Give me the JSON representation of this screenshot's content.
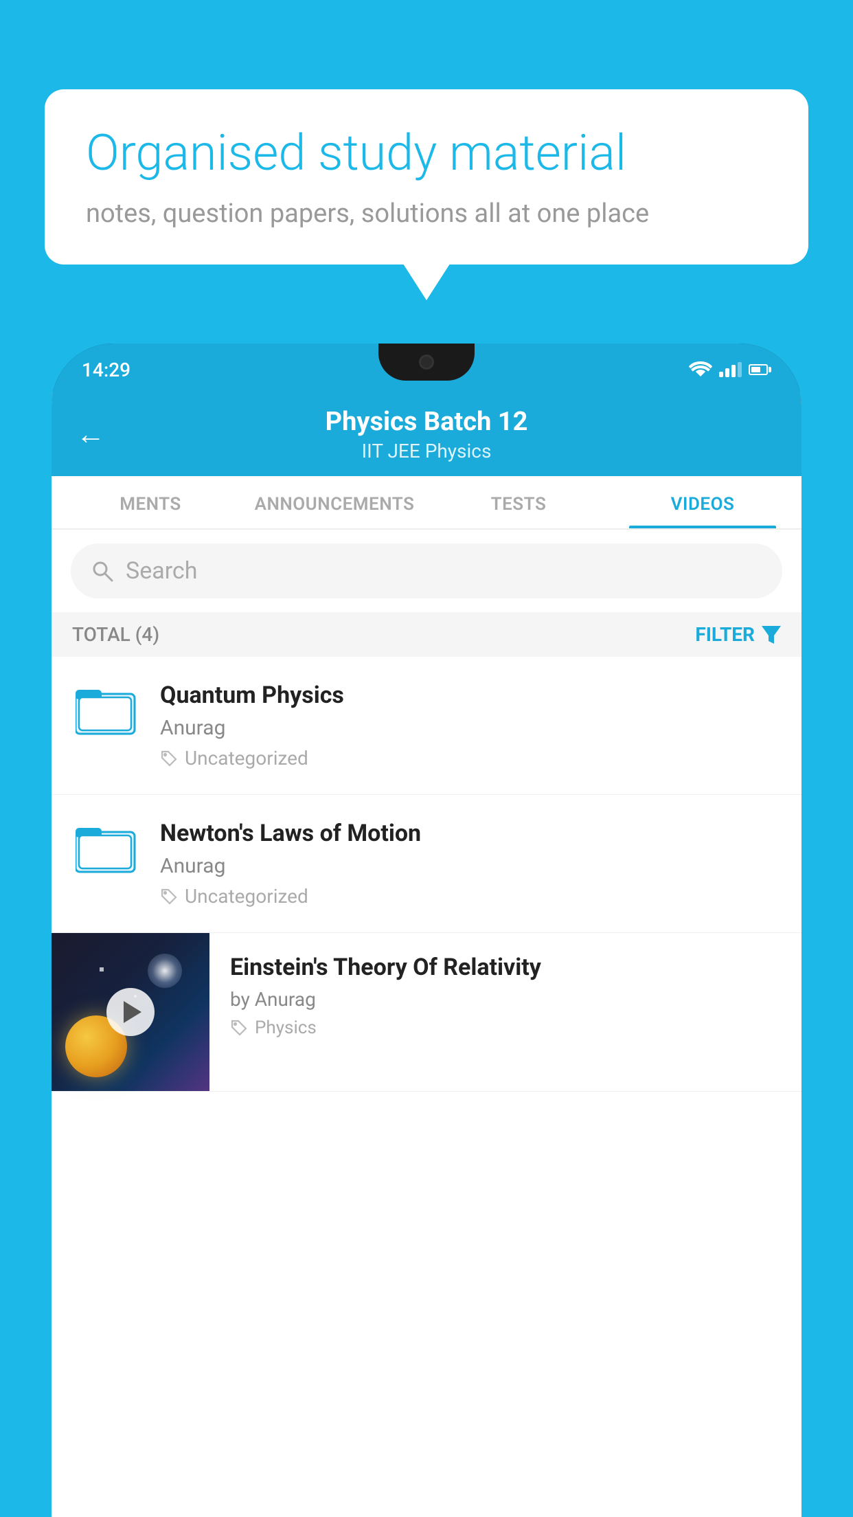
{
  "background_color": "#1BB8E8",
  "speech_bubble": {
    "headline": "Organised study material",
    "subtext": "notes, question papers, solutions all at one place"
  },
  "phone": {
    "status_bar": {
      "time": "14:29",
      "wifi_icon": "wifi",
      "signal_icon": "signal",
      "battery_icon": "battery"
    },
    "header": {
      "back_label": "←",
      "title": "Physics Batch 12",
      "subtitle": "IIT JEE   Physics"
    },
    "tabs": [
      {
        "label": "MENTS",
        "active": false
      },
      {
        "label": "ANNOUNCEMENTS",
        "active": false
      },
      {
        "label": "TESTS",
        "active": false
      },
      {
        "label": "VIDEOS",
        "active": true
      }
    ],
    "search": {
      "placeholder": "Search"
    },
    "filter_row": {
      "total_label": "TOTAL (4)",
      "filter_label": "FILTER"
    },
    "videos": [
      {
        "title": "Quantum Physics",
        "author": "Anurag",
        "tag": "Uncategorized",
        "has_thumbnail": false
      },
      {
        "title": "Newton's Laws of Motion",
        "author": "Anurag",
        "tag": "Uncategorized",
        "has_thumbnail": false
      },
      {
        "title": "Einstein's Theory Of Relativity",
        "author": "by Anurag",
        "tag": "Physics",
        "has_thumbnail": true
      }
    ]
  }
}
